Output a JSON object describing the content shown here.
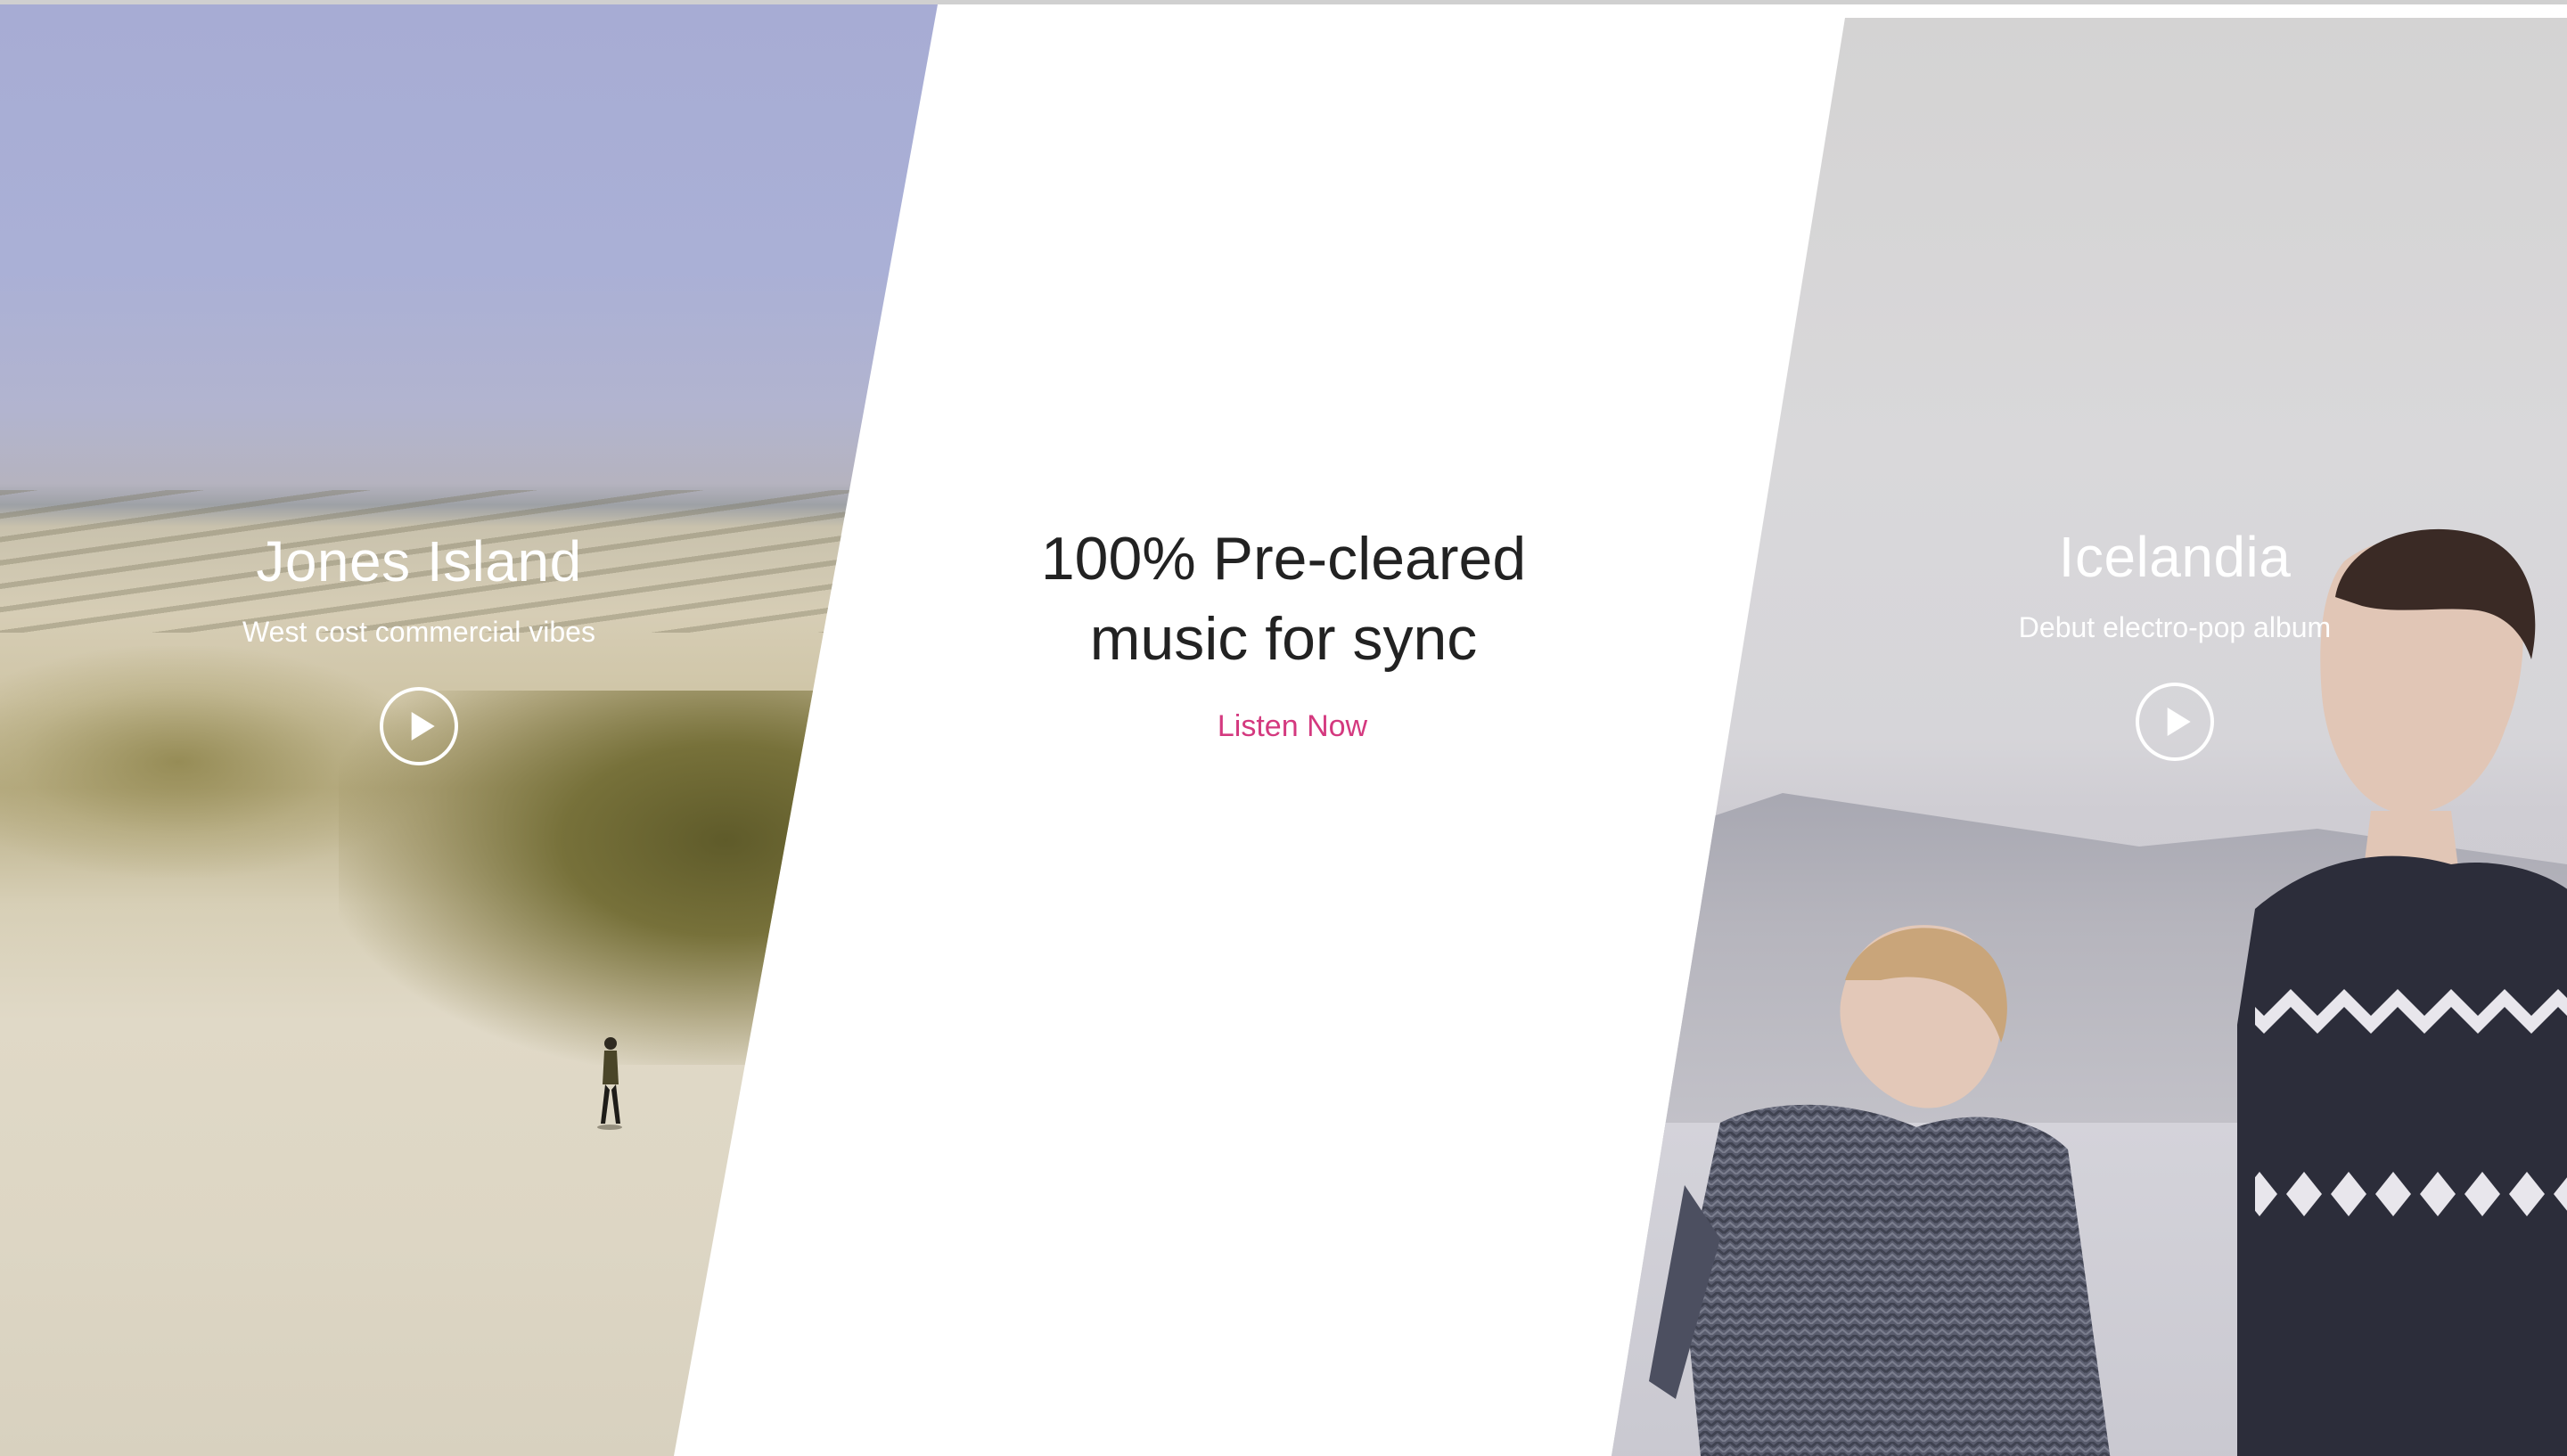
{
  "left_panel": {
    "title": "Jones Island",
    "subtitle": "West cost commercial vibes",
    "play_icon": "play-icon"
  },
  "center": {
    "heading_line1": "100% Pre-cleared",
    "heading_line2": "music for sync",
    "cta_label": "Listen Now"
  },
  "right_panel": {
    "title": "Icelandia",
    "subtitle": "Debut electro-pop album",
    "play_icon": "play-icon"
  },
  "colors": {
    "accent": "#d4397f",
    "heading": "#222222",
    "overlay_text": "#ffffff"
  }
}
